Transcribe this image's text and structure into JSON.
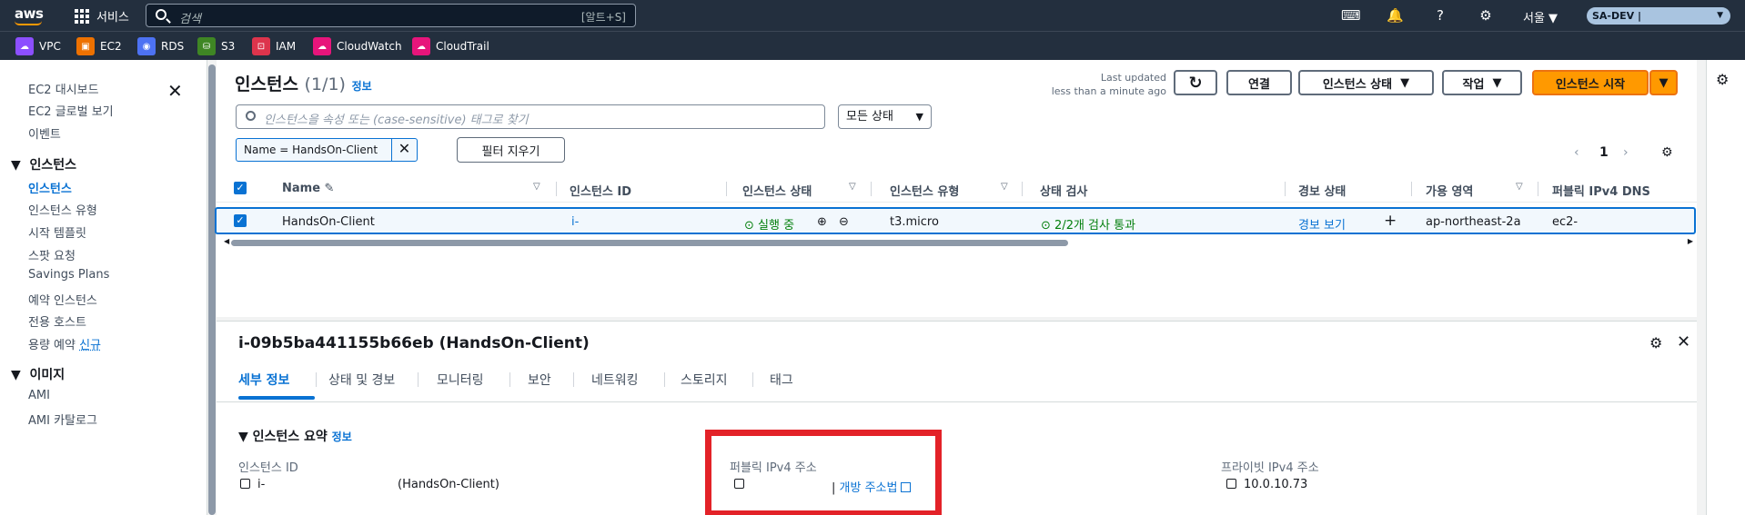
{
  "topnav": {
    "logo": "aws",
    "services_label": "서비스",
    "search_placeholder": "검색",
    "search_shortcut": "[알트+S]",
    "region": "서울 ▼",
    "account": "SA-DEV |",
    "icons": [
      "cloudshell-icon",
      "bell-icon",
      "help-icon",
      "settings-icon"
    ]
  },
  "favorites": [
    {
      "label": "VPC",
      "color": "#8c4fff"
    },
    {
      "label": "EC2",
      "color": "#ed7100"
    },
    {
      "label": "RDS",
      "color": "#4d72f3"
    },
    {
      "label": "S3",
      "color": "#3f8624"
    },
    {
      "label": "IAM",
      "color": "#dd344c"
    },
    {
      "label": "CloudWatch",
      "color": "#e7157b"
    },
    {
      "label": "CloudTrail",
      "color": "#e7157b"
    }
  ],
  "sidebar": {
    "items_top": [
      "EC2 대시보드",
      "EC2 글로벌 보기",
      "이벤트"
    ],
    "section_instances": "인스턴스",
    "instances_items": [
      "인스턴스",
      "인스턴스 유형",
      "시작 템플릿",
      "스팟 요청",
      "Savings Plans",
      "예약 인스턴스",
      "전용 호스트",
      "용량 예약"
    ],
    "new_badge": "신규",
    "section_images": "이미지",
    "images_items": [
      "AMI",
      "AMI 카탈로그"
    ]
  },
  "main": {
    "title": "인스턴스",
    "count": "(1/1)",
    "info": "정보",
    "last_updated_1": "Last updated",
    "last_updated_2": "less than a minute ago",
    "btn_connect": "연결",
    "btn_state": "인스턴스 상태",
    "btn_actions": "작업",
    "btn_launch": "인스턴스 시작",
    "filter_placeholder": "인스턴스을 속성 또는 (case-sensitive) 태그로 찾기",
    "state_select": "모든 상태",
    "token": "Name = HandsOn-Client",
    "clear_filters": "필터 지우기",
    "page": "1",
    "columns": [
      "Name",
      "인스턴스 ID",
      "인스턴스 상태",
      "인스턴스 유형",
      "상태 검사",
      "경보 상태",
      "가용 영역",
      "퍼블릭 IPv4 DNS"
    ],
    "row": {
      "name": "HandsOn-Client",
      "id": "i-",
      "state": "실행 중",
      "type": "t3.micro",
      "check": "2/2개 검사 통과",
      "alarm": "경보 보기",
      "az": "ap-northeast-2a",
      "dns": "ec2-"
    }
  },
  "detail": {
    "title": "i-09b5ba441155b66eb (HandsOn-Client)",
    "tabs": [
      "세부 정보",
      "상태 및 경보",
      "모니터링",
      "보안",
      "네트워킹",
      "스토리지",
      "태그"
    ],
    "summary_head": "인스턴스 요약",
    "summary_info": "정보",
    "id_label": "인스턴스 ID",
    "id_value": "i-",
    "id_suffix": "(HandsOn-Client)",
    "public_ip_label": "퍼블릭 IPv4 주소",
    "open_address": "개방 주소법",
    "private_ip_label": "프라이빗 IPv4 주소",
    "private_ip_value": "10.0.10.73"
  }
}
